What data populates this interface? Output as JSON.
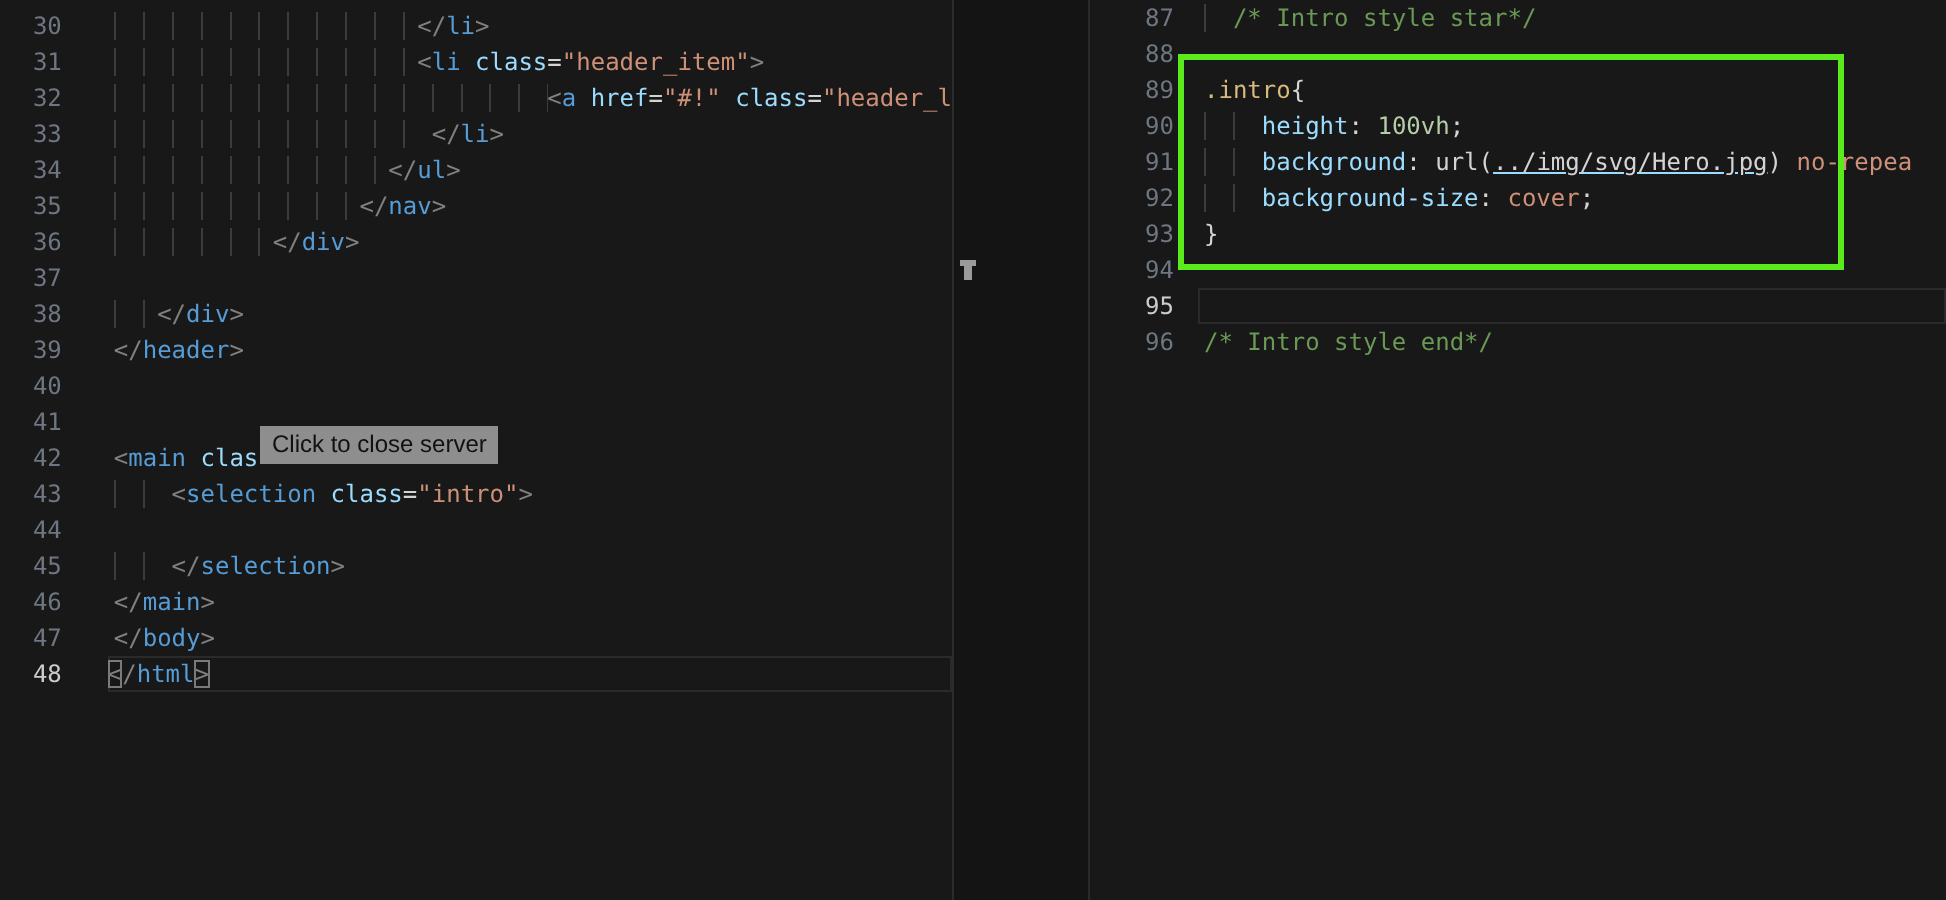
{
  "tooltip": {
    "text": "Click to close server"
  },
  "editors": [
    {
      "lines": [
        {
          "number": "30",
          "active": false,
          "tokens": [
            {
              "kind": "punct",
              "text": "                     </"
            },
            {
              "kind": "tag",
              "text": "li"
            },
            {
              "kind": "punct",
              "text": ">"
            }
          ]
        },
        {
          "number": "31",
          "active": false,
          "tokens": [
            {
              "kind": "punct",
              "text": "                     <"
            },
            {
              "kind": "tag",
              "text": "li"
            },
            {
              "kind": "attr",
              "text": " class"
            },
            {
              "kind": "plain",
              "text": "="
            },
            {
              "kind": "string",
              "text": "\"header_item\""
            },
            {
              "kind": "punct",
              "text": ">"
            }
          ]
        },
        {
          "number": "32",
          "active": false,
          "tokens": [
            {
              "kind": "punct",
              "text": "                              <"
            },
            {
              "kind": "tag",
              "text": "a"
            },
            {
              "kind": "attr",
              "text": " href"
            },
            {
              "kind": "plain",
              "text": "="
            },
            {
              "kind": "string",
              "text": "\"#!\""
            },
            {
              "kind": "attr",
              "text": " class"
            },
            {
              "kind": "plain",
              "text": "="
            },
            {
              "kind": "string",
              "text": "\"header_l"
            }
          ]
        },
        {
          "number": "33",
          "active": false,
          "tokens": [
            {
              "kind": "punct",
              "text": "                      </"
            },
            {
              "kind": "tag",
              "text": "li"
            },
            {
              "kind": "punct",
              "text": ">"
            }
          ]
        },
        {
          "number": "34",
          "active": false,
          "tokens": [
            {
              "kind": "punct",
              "text": "                   </"
            },
            {
              "kind": "tag",
              "text": "ul"
            },
            {
              "kind": "punct",
              "text": ">"
            }
          ]
        },
        {
          "number": "35",
          "active": false,
          "tokens": [
            {
              "kind": "punct",
              "text": "                 </"
            },
            {
              "kind": "tag",
              "text": "nav"
            },
            {
              "kind": "punct",
              "text": ">"
            }
          ]
        },
        {
          "number": "36",
          "active": false,
          "tokens": [
            {
              "kind": "punct",
              "text": "           </"
            },
            {
              "kind": "tag",
              "text": "div"
            },
            {
              "kind": "punct",
              "text": ">"
            }
          ]
        },
        {
          "number": "37",
          "active": false
        },
        {
          "number": "38",
          "active": false,
          "tokens": [
            {
              "kind": "punct",
              "text": "   </"
            },
            {
              "kind": "tag",
              "text": "div"
            },
            {
              "kind": "punct",
              "text": ">"
            }
          ]
        },
        {
          "number": "39",
          "active": false,
          "tokens": [
            {
              "kind": "punct",
              "text": "</"
            },
            {
              "kind": "tag",
              "text": "header"
            },
            {
              "kind": "punct",
              "text": ">"
            }
          ]
        },
        {
          "number": "40",
          "active": false
        },
        {
          "number": "41",
          "active": false
        },
        {
          "number": "42",
          "active": false,
          "tokens": [
            {
              "kind": "punct",
              "text": "<"
            },
            {
              "kind": "tag",
              "text": "main"
            },
            {
              "kind": "attr",
              "text": " clas"
            }
          ]
        },
        {
          "number": "43",
          "active": false,
          "tokens": [
            {
              "kind": "punct",
              "text": "    <"
            },
            {
              "kind": "tag",
              "text": "selection"
            },
            {
              "kind": "attr",
              "text": " class"
            },
            {
              "kind": "plain",
              "text": "="
            },
            {
              "kind": "string",
              "text": "\"intro\""
            },
            {
              "kind": "punct",
              "text": ">"
            }
          ]
        },
        {
          "number": "44",
          "active": false
        },
        {
          "number": "45",
          "active": false,
          "tokens": [
            {
              "kind": "punct",
              "text": "    </"
            },
            {
              "kind": "tag",
              "text": "selection"
            },
            {
              "kind": "punct",
              "text": ">"
            }
          ]
        },
        {
          "number": "46",
          "active": false,
          "tokens": [
            {
              "kind": "punct",
              "text": "</"
            },
            {
              "kind": "tag",
              "text": "main"
            },
            {
              "kind": "punct",
              "text": ">"
            }
          ]
        },
        {
          "number": "47",
          "active": false,
          "tokens": [
            {
              "kind": "punct",
              "text": "</"
            },
            {
              "kind": "tag",
              "text": "body"
            },
            {
              "kind": "punct",
              "text": ">"
            }
          ]
        },
        {
          "number": "48",
          "active": true,
          "tokens": [
            {
              "kind": "bracket",
              "text": "<"
            },
            {
              "kind": "punct",
              "text": "/"
            },
            {
              "kind": "tag",
              "text": "html"
            },
            {
              "kind": "bracket",
              "text": ">"
            }
          ]
        }
      ]
    },
    {
      "sections": [
        {
          "highlighted": false,
          "lines": [
            {
              "number": "87",
              "active": false,
              "marker": false,
              "tokens": [
                {
                  "kind": "comment",
                  "text": "  /* Intro style star*/"
                }
              ]
            },
            {
              "number": "88",
              "active": false,
              "marker": false
            }
          ]
        },
        {
          "highlighted": true,
          "lines": [
            {
              "number": "89",
              "active": false,
              "marker": false,
              "tokens": [
                {
                  "kind": "selector",
                  "text": ".intro"
                },
                {
                  "kind": "plain",
                  "text": "{"
                }
              ]
            },
            {
              "number": "90",
              "active": false,
              "marker": false,
              "tokens": [
                {
                  "kind": "property",
                  "text": "    height"
                },
                {
                  "kind": "plain",
                  "text": ": "
                },
                {
                  "kind": "number",
                  "text": "100vh"
                },
                {
                  "kind": "plain",
                  "text": ";"
                }
              ]
            },
            {
              "number": "91",
              "active": false,
              "marker": false,
              "tokens": [
                {
                  "kind": "property",
                  "text": "    background"
                },
                {
                  "kind": "plain",
                  "text": ": "
                },
                {
                  "kind": "function",
                  "text": "url("
                },
                {
                  "kind": "link",
                  "text": "../img/svg/Hero.jpg"
                },
                {
                  "kind": "function",
                  "text": ")"
                },
                {
                  "kind": "string",
                  "text": " no-repea"
                }
              ]
            },
            {
              "number": "92",
              "active": false,
              "marker": false,
              "tokens": [
                {
                  "kind": "property",
                  "text": "    background-size"
                },
                {
                  "kind": "plain",
                  "text": ": "
                },
                {
                  "kind": "string",
                  "text": "cover"
                },
                {
                  "kind": "plain",
                  "text": ";"
                }
              ]
            },
            {
              "number": "93",
              "active": false,
              "marker": false,
              "tokens": [
                {
                  "kind": "plain",
                  "text": "}"
                }
              ]
            }
          ]
        },
        {
          "highlighted": false,
          "lines": [
            {
              "number": "94",
              "active": false,
              "marker": true
            },
            {
              "number": "95",
              "active": true,
              "marker": false
            },
            {
              "number": "96",
              "active": false,
              "marker": false,
              "tokens": [
                {
                  "kind": "comment",
                  "text": "/* Intro style end*/"
                }
              ]
            }
          ]
        }
      ]
    }
  ]
}
